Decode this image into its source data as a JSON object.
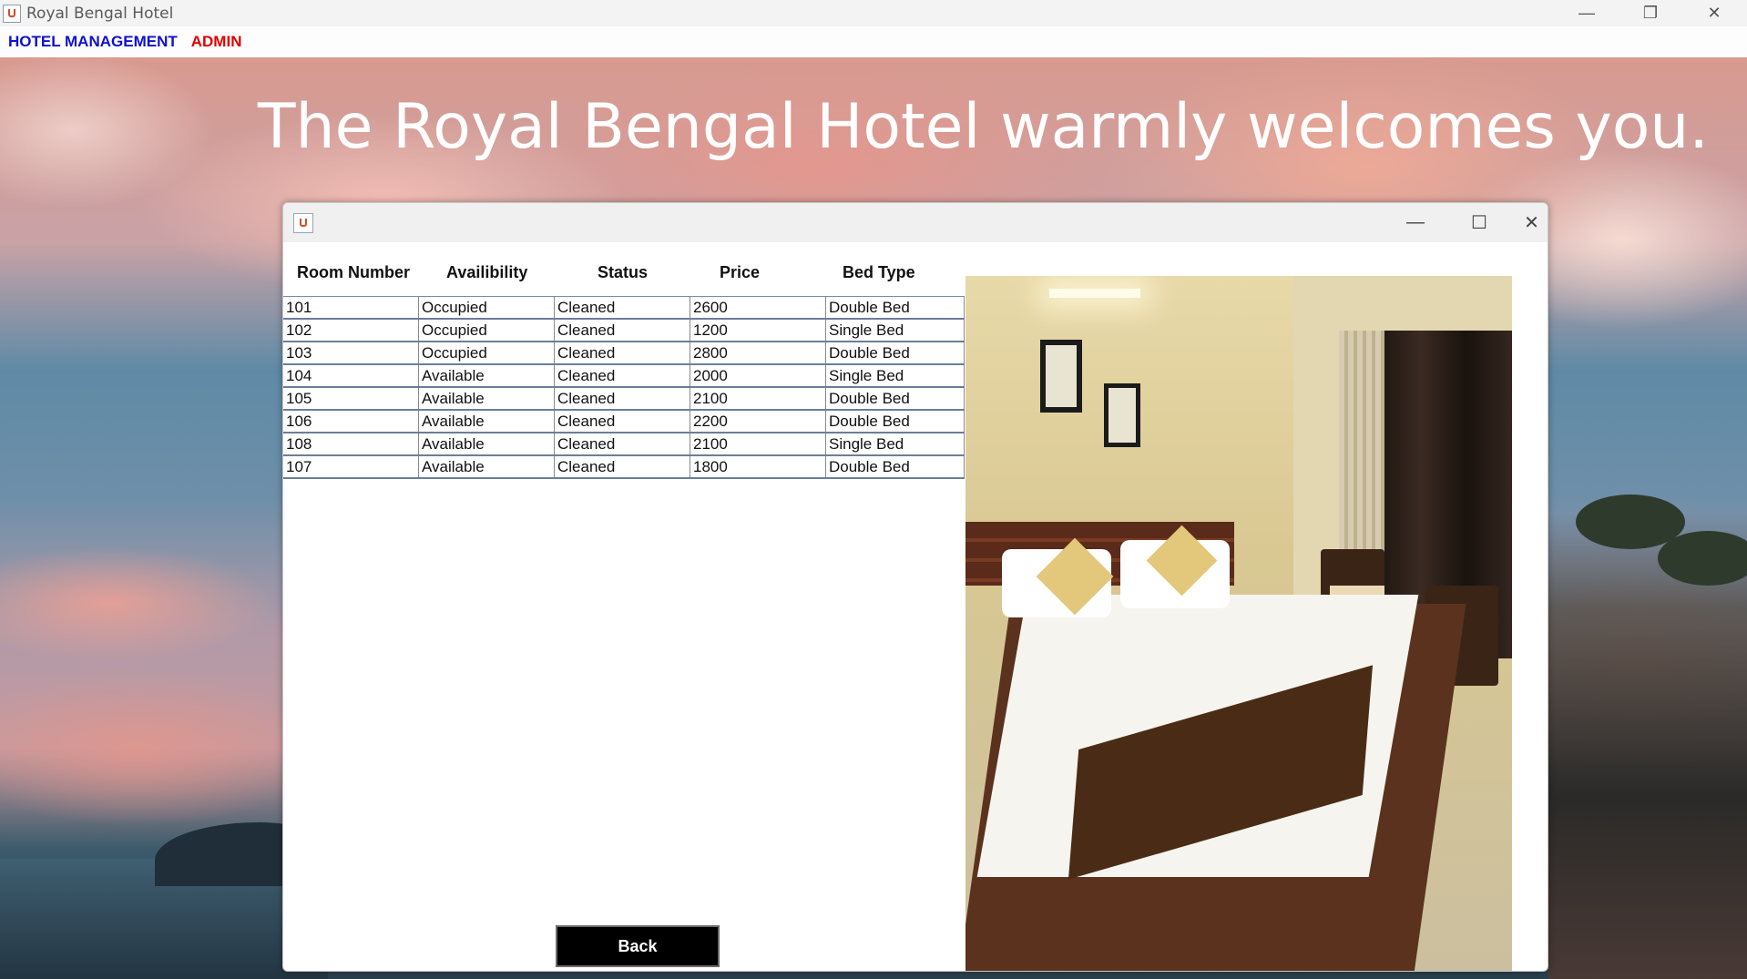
{
  "window": {
    "title": "Royal Bengal Hotel",
    "controls": {
      "minimize": "—",
      "restore": "❐",
      "close": "✕"
    }
  },
  "menu": {
    "items": [
      {
        "label": "HOTEL MANAGEMENT",
        "color": "#1010d0"
      },
      {
        "label": "ADMIN",
        "color": "#e00000"
      }
    ]
  },
  "headline": "The Royal Bengal Hotel warmly welcomes you.",
  "dialog": {
    "title": "",
    "controls": {
      "minimize": "—",
      "maximize": "☐",
      "close": "✕"
    },
    "table": {
      "columns": [
        "Room Number",
        "Availibility",
        "Status",
        "Price",
        "Bed Type"
      ],
      "rows": [
        [
          "101",
          "Occupied",
          "Cleaned",
          "2600",
          "Double Bed"
        ],
        [
          "102",
          "Occupied",
          "Cleaned",
          "1200",
          "Single Bed"
        ],
        [
          "103",
          "Occupied",
          "Cleaned",
          "2800",
          "Double Bed"
        ],
        [
          "104",
          "Available",
          "Cleaned",
          "2000",
          "Single Bed"
        ],
        [
          "105",
          "Available",
          "Cleaned",
          "2100",
          "Double Bed"
        ],
        [
          "106",
          "Available",
          "Cleaned",
          "2200",
          "Double Bed"
        ],
        [
          "108",
          "Available",
          "Cleaned",
          "2100",
          "Single Bed"
        ],
        [
          "107",
          "Available",
          "Cleaned",
          "1800",
          "Double Bed"
        ]
      ]
    },
    "back_button": "Back",
    "photo_icon": "hotel-room-image"
  }
}
